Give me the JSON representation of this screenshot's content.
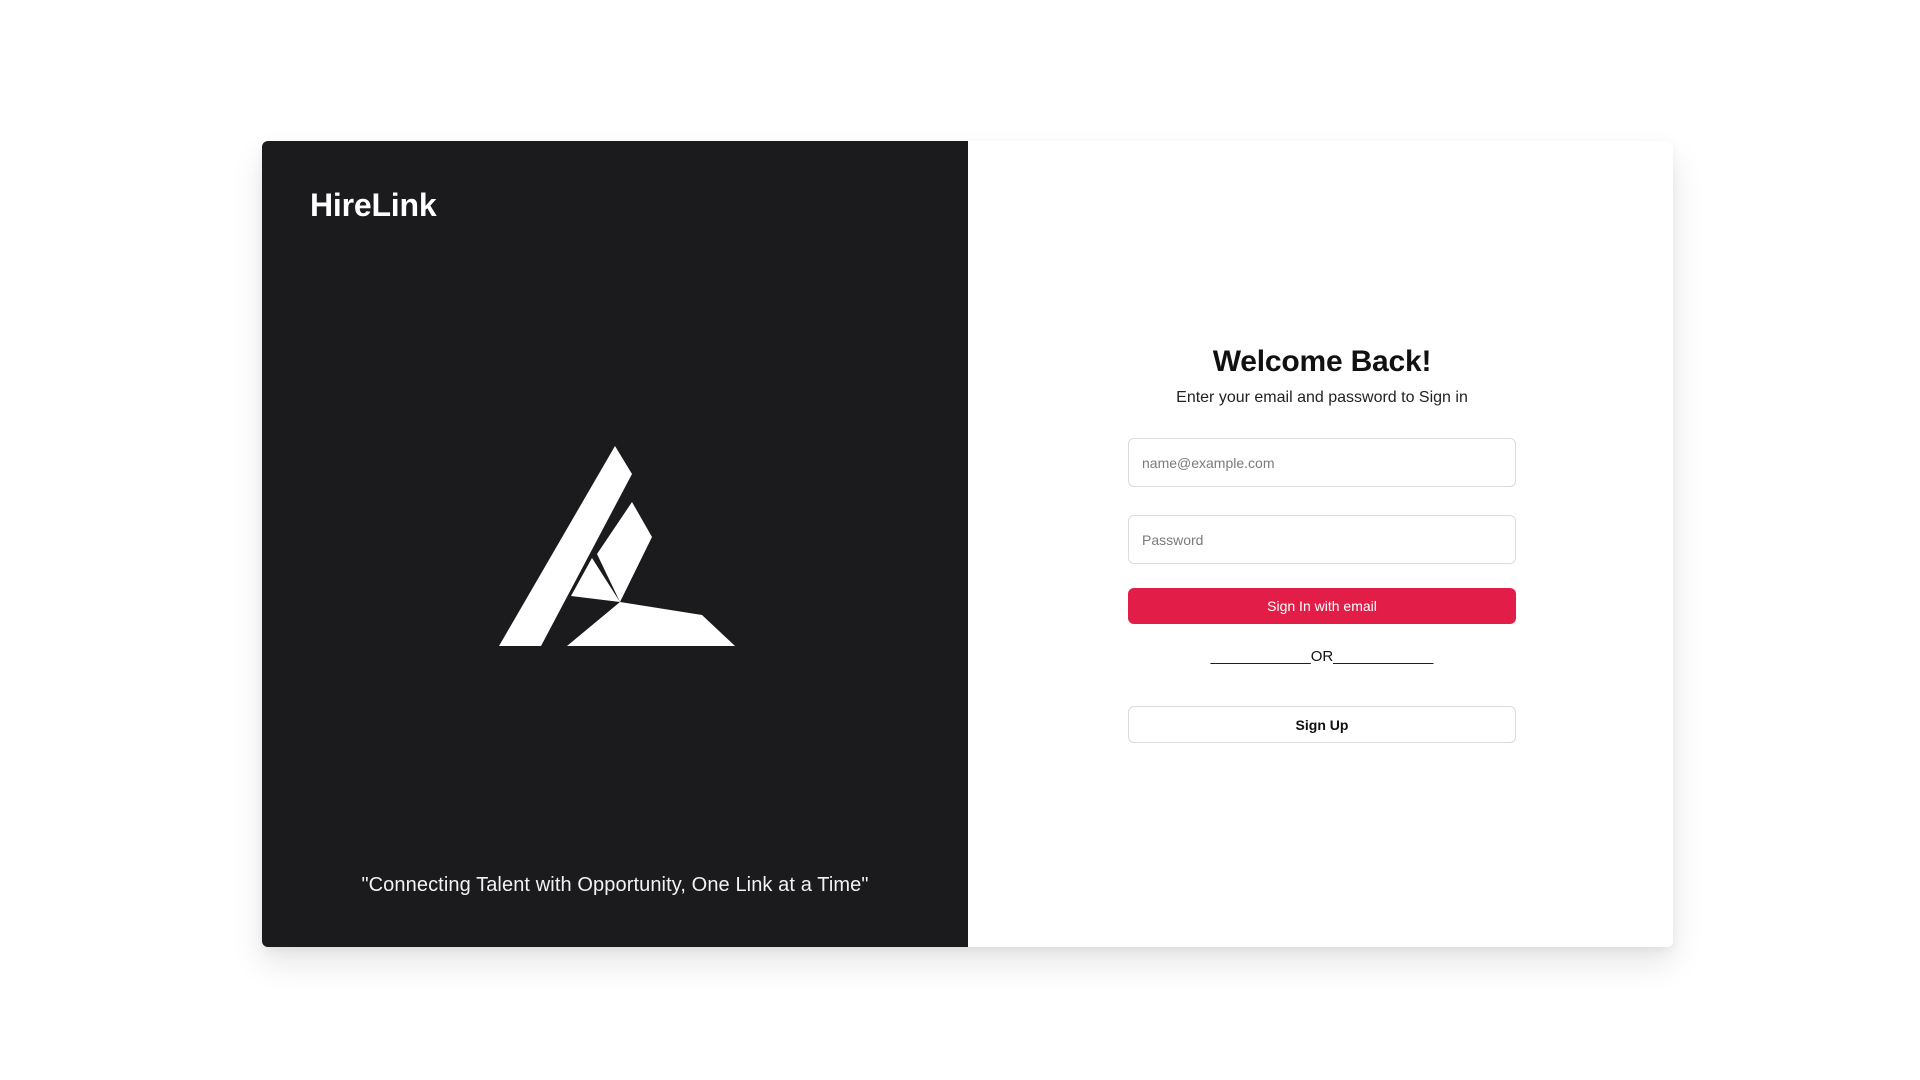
{
  "brand": {
    "name": "HireLink",
    "logo_icon": "hirelink-monogram-logo",
    "tagline": "\"Connecting Talent with Opportunity, One Link at a Time\""
  },
  "signin": {
    "title": "Welcome Back!",
    "subtitle": "Enter your email and password to Sign in",
    "email_placeholder": "name@example.com",
    "password_placeholder": "Password",
    "submit_label": "Sign In with email",
    "divider_text": "____________OR____________",
    "signup_label": "Sign Up"
  },
  "colors": {
    "brand_panel_bg": "#1b1b1d",
    "primary_button": "#e11d48",
    "page_bg": "#ffffff"
  }
}
